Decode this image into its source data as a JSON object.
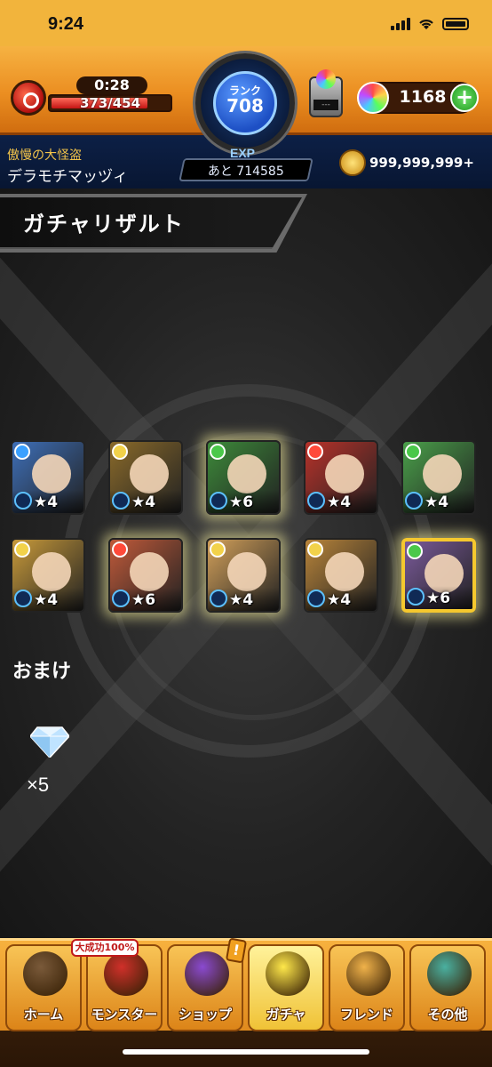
{
  "status_bar": {
    "time": "9:24"
  },
  "header": {
    "stamina_timer": "0:28",
    "stamina_value": "373/454",
    "stamina_fraction": 0.82,
    "rank_label": "ランク",
    "rank_value": "708",
    "exp_label": "EXP",
    "exp_remaining": "あと 714585",
    "box_label": "---",
    "orb_count": "1168",
    "orb_plus": "+",
    "player_title": "傲慢の大怪盗",
    "player_name": "デラモチマッヅィ",
    "coin_value": "999,999,999+"
  },
  "result": {
    "title": "ガチャリザルト",
    "cards": [
      {
        "element": "water",
        "elem_color": "#3aa0ff",
        "bg": "#3e6fb8",
        "stars": "★4",
        "glow": false,
        "selected": false
      },
      {
        "element": "light",
        "elem_color": "#f2d24a",
        "bg": "#8a6a2a",
        "stars": "★4",
        "glow": false,
        "selected": false
      },
      {
        "element": "wood",
        "elem_color": "#4ac84a",
        "bg": "#3d8a3a",
        "stars": "★6",
        "glow": true,
        "selected": false
      },
      {
        "element": "fire",
        "elem_color": "#ff4a3a",
        "bg": "#b8322a",
        "stars": "★4",
        "glow": false,
        "selected": false
      },
      {
        "element": "wood",
        "elem_color": "#4ac84a",
        "bg": "#4aa04a",
        "stars": "★4",
        "glow": false,
        "selected": false
      },
      {
        "element": "light",
        "elem_color": "#f2d24a",
        "bg": "#c89a3a",
        "stars": "★4",
        "glow": false,
        "selected": false
      },
      {
        "element": "fire",
        "elem_color": "#ff4a3a",
        "bg": "#c05a3a",
        "stars": "★6",
        "glow": true,
        "selected": false
      },
      {
        "element": "light",
        "elem_color": "#f2d24a",
        "bg": "#d2a05a",
        "stars": "★4",
        "glow": true,
        "selected": false
      },
      {
        "element": "light",
        "elem_color": "#f2d24a",
        "bg": "#b8843a",
        "stars": "★4",
        "glow": false,
        "selected": false
      },
      {
        "element": "wood",
        "elem_color": "#4ac84a",
        "bg": "#7a5a9a",
        "stars": "★6",
        "glow": true,
        "selected": true
      }
    ],
    "bonus_title": "おまけ",
    "bonus_count": "×5"
  },
  "nav": {
    "items": [
      {
        "label": "ホーム",
        "icon": "home-icon",
        "color": "#7a5a3a"
      },
      {
        "label": "モンスター",
        "icon": "monster-icon",
        "color": "#d0302a"
      },
      {
        "label": "ショップ",
        "icon": "shop-orb-icon",
        "color": "#8a4ad0"
      },
      {
        "label": "ガチャ",
        "icon": "gacha-icon",
        "color": "#ffe84a"
      },
      {
        "label": "フレンド",
        "icon": "friend-icon",
        "color": "#f0b24a"
      },
      {
        "label": "その他",
        "icon": "other-icon",
        "color": "#4ab0a0"
      }
    ],
    "monster_tag": "大成功100%",
    "shop_alert": "!"
  }
}
